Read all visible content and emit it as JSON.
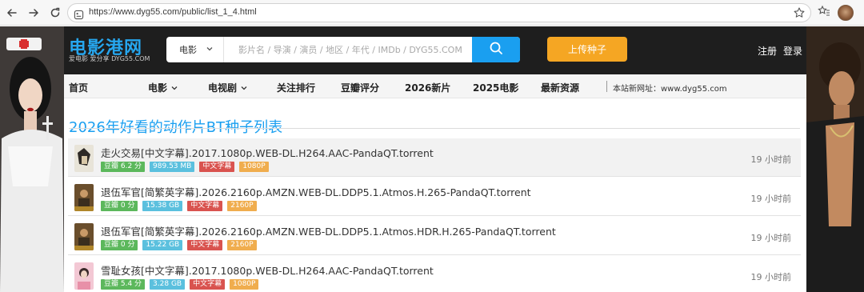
{
  "browser": {
    "url": "https://www.dyg55.com/public/list_1_4.html"
  },
  "site": {
    "logo": "电影港网",
    "logo_sub": "爱电影 爱分享 DYG55.COM",
    "search_category": "电影",
    "search_placeholder": "影片名 / 导演 / 演员 / 地区 / 年代 / IMDb / DYG55.COM",
    "upload_label": "上传种子",
    "register_label": "注册",
    "login_label": "登录"
  },
  "nav": {
    "items": [
      "首页",
      "电影",
      "电视剧",
      "关注排行",
      "豆瓣评分",
      "2026新片",
      "2025电影",
      "最新资源"
    ],
    "note": "本站新网址：www.dyg55.com"
  },
  "main": {
    "title": "2026年好看的动作片BT种子列表",
    "items": [
      {
        "title": "走火交易[中文字幕].2017.1080p.WEB-DL.H264.AAC-PandaQT.torrent",
        "rating": "豆瓣 6.2 分",
        "size": "989.53 MB",
        "subtitle": "中文字幕",
        "quality": "1080P",
        "time": "19 小时前"
      },
      {
        "title": "退伍军官[简繁英字幕].2026.2160p.AMZN.WEB-DL.DDP5.1.Atmos.H.265-PandaQT.torrent",
        "rating": "豆瓣 0 分",
        "size": "15.38 GB",
        "subtitle": "中文字幕",
        "quality": "2160P",
        "time": "19 小时前"
      },
      {
        "title": "退伍军官[简繁英字幕].2026.2160p.AMZN.WEB-DL.DDP5.1.Atmos.HDR.H.265-PandaQT.torrent",
        "rating": "豆瓣 0 分",
        "size": "15.22 GB",
        "subtitle": "中文字幕",
        "quality": "2160P",
        "time": "19 小时前"
      },
      {
        "title": "雪耻女孩[中文字幕].2017.1080p.WEB-DL.H264.AAC-PandaQT.torrent",
        "rating": "豆瓣 5.4 分",
        "size": "3.28 GB",
        "subtitle": "中文字幕",
        "quality": "1080P",
        "time": "19 小时前"
      }
    ]
  },
  "colors": {
    "accent": "#1a9ff0",
    "upload": "#f5a623",
    "header_bg": "#1e1e1e",
    "badge_rating": "#5cb85c",
    "badge_size": "#5bc0de",
    "badge_subtitle": "#d9534f",
    "badge_quality": "#f0ad4e"
  },
  "icons": [
    "back-icon",
    "forward-icon",
    "reload-icon",
    "site-info-icon",
    "star-icon",
    "favorites-icon",
    "extensions-icon",
    "search-icon",
    "chevron-down-icon"
  ]
}
